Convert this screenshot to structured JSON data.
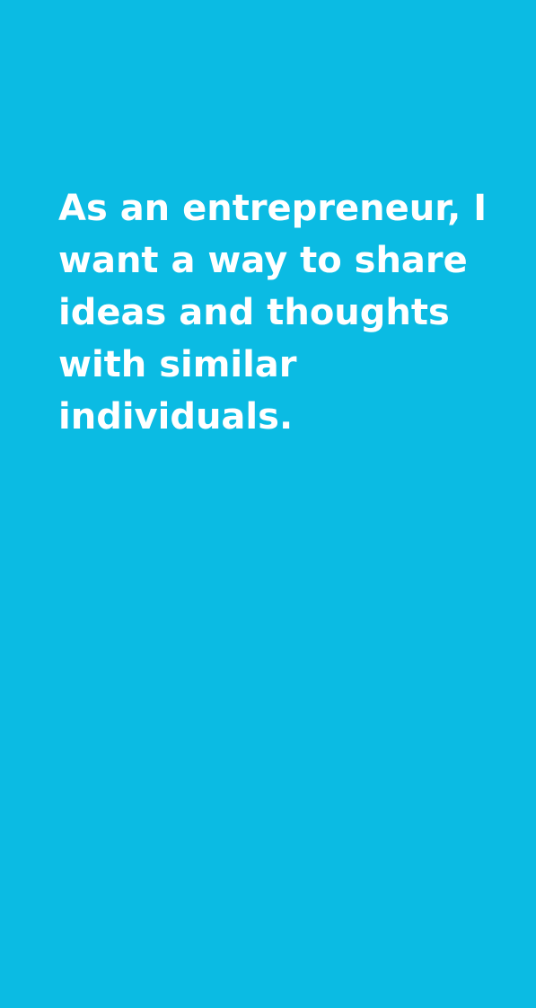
{
  "screen": {
    "background_color": "#0bbbe3",
    "text_color": "#ffffff"
  },
  "user_story": {
    "lines": [
      "As an entrepreneur, I",
      "want a way to share",
      "ideas and thoughts",
      "with similar",
      "individuals."
    ]
  }
}
